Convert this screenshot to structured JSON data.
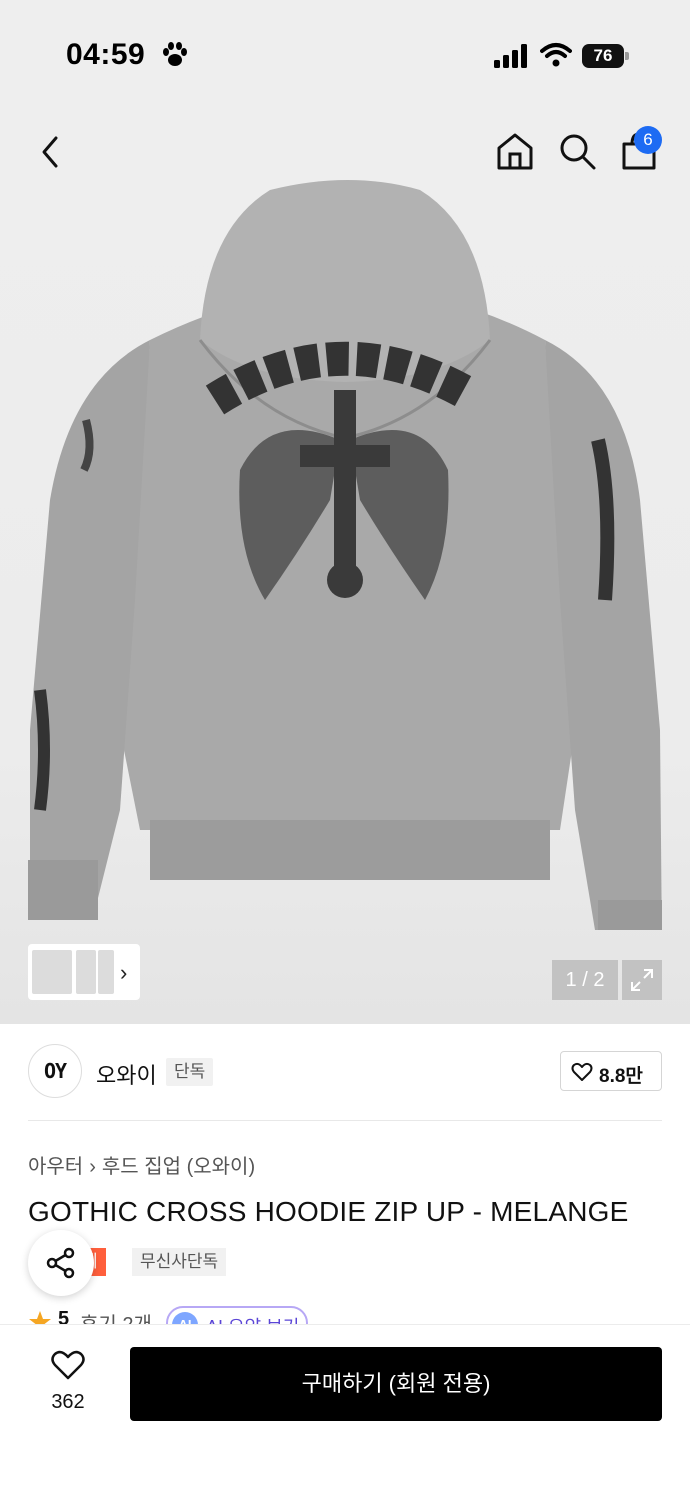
{
  "status_bar": {
    "time": "04:59",
    "battery": "76"
  },
  "nav": {
    "cart_count": "6"
  },
  "gallery": {
    "counter": "1 / 2"
  },
  "brand": {
    "logo_text": "OY",
    "name": "오와이",
    "tag": "단독",
    "likes": "8.8만"
  },
  "product": {
    "category_main": "아우터",
    "category_sub": "후드 집업 (오와이)",
    "title": "GOTHIC CROSS HOODIE ZIP UP - MELANGE",
    "tag_sale": "세일",
    "tag_exclusive": "무신사단독",
    "rating": "5",
    "reviews": "후기 2개",
    "ai_badge": "AI",
    "ai_summary": "AI 요약 보기"
  },
  "bottom": {
    "wish_count": "362",
    "buy_label": "구매하기 (회원 전용)"
  },
  "colors": {
    "accent": "#1d6bf3",
    "sale": "#ff5f3c",
    "buy_bg": "#000000",
    "ai": "#5b46d6"
  },
  "icons": [
    "paw-icon",
    "signal-icon",
    "wifi-icon",
    "battery-icon",
    "back-icon",
    "home-icon",
    "search-icon",
    "cart-icon",
    "expand-icon",
    "heart-icon",
    "share-icon",
    "star-icon"
  ]
}
